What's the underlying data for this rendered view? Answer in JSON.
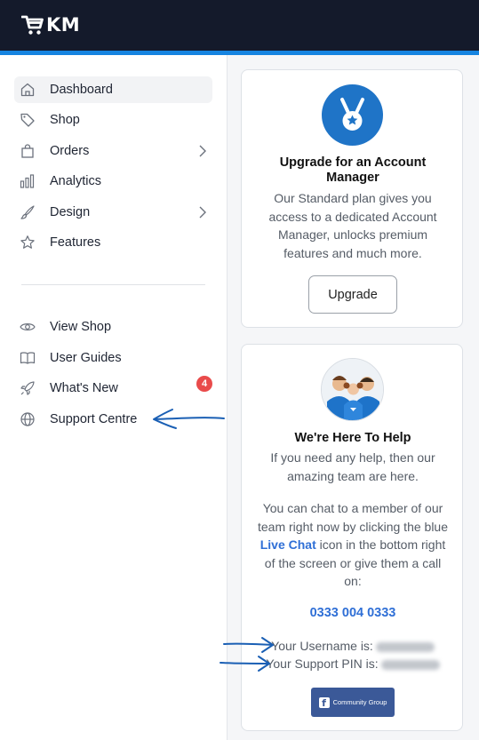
{
  "header": {
    "logo_text": "KM",
    "accent_color": "#1684e0",
    "bg_color": "#141a2b"
  },
  "sidebar": {
    "primary": [
      {
        "label": "Dashboard",
        "icon": "home-icon",
        "active": true
      },
      {
        "label": "Shop",
        "icon": "tag-icon"
      },
      {
        "label": "Orders",
        "icon": "shopping-bag-icon",
        "has_submenu": true
      },
      {
        "label": "Analytics",
        "icon": "bar-chart-icon"
      },
      {
        "label": "Design",
        "icon": "brush-icon",
        "has_submenu": true
      },
      {
        "label": "Features",
        "icon": "star-icon"
      }
    ],
    "secondary": [
      {
        "label": "View Shop",
        "icon": "eye-icon"
      },
      {
        "label": "User Guides",
        "icon": "book-icon"
      },
      {
        "label": "What's New",
        "icon": "rocket-icon",
        "badge": "4"
      },
      {
        "label": "Support Centre",
        "icon": "globe-icon"
      }
    ]
  },
  "upgrade_card": {
    "icon": "medal-icon",
    "title": "Upgrade for an Account Manager",
    "body": "Our Standard plan gives you access to a dedicated Account Manager, unlocks premium features and much more.",
    "button_label": "Upgrade"
  },
  "help_card": {
    "image": "support-team-photo",
    "title": "We're Here To Help",
    "intro": "If you need any help, then our amazing team are here.",
    "chat_before": "You can chat to a member of our team right now by clicking the blue ",
    "chat_link": "Live Chat",
    "chat_after": " icon in the bottom right of the screen or give them a call on:",
    "phone": "0333 004 0333",
    "username_label": "Your Username is:",
    "pin_label": "Your Support PIN is:",
    "facebook_label": "Community Group"
  }
}
